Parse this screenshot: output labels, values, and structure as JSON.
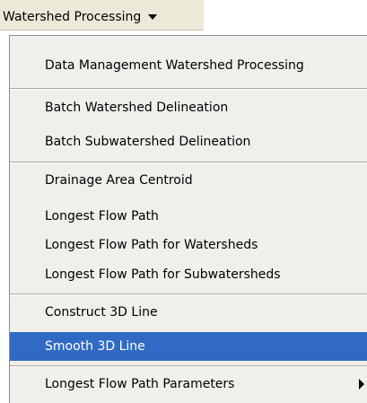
{
  "menu_button": {
    "label": "Watershed Processing",
    "icon": "chevron-down-icon"
  },
  "dropdown": {
    "items": [
      {
        "label": "Data Management Watershed Processing"
      },
      {
        "label": "Batch Watershed Delineation"
      },
      {
        "label": "Batch Subwatershed Delineation"
      },
      {
        "label": "Drainage Area Centroid"
      },
      {
        "label": "Longest Flow Path"
      },
      {
        "label": "Longest Flow Path for Watersheds"
      },
      {
        "label": "Longest Flow Path for Subwatersheds"
      },
      {
        "label": "Construct 3D Line"
      },
      {
        "label": "Smooth 3D Line",
        "highlighted": true
      },
      {
        "label": "Longest Flow Path Parameters",
        "has_submenu": true,
        "submenu_icon": "chevron-right-icon"
      }
    ]
  },
  "colors": {
    "highlight": "#316ac5",
    "menu_background": "#f0efeb",
    "bar_background": "#ece9d8"
  }
}
